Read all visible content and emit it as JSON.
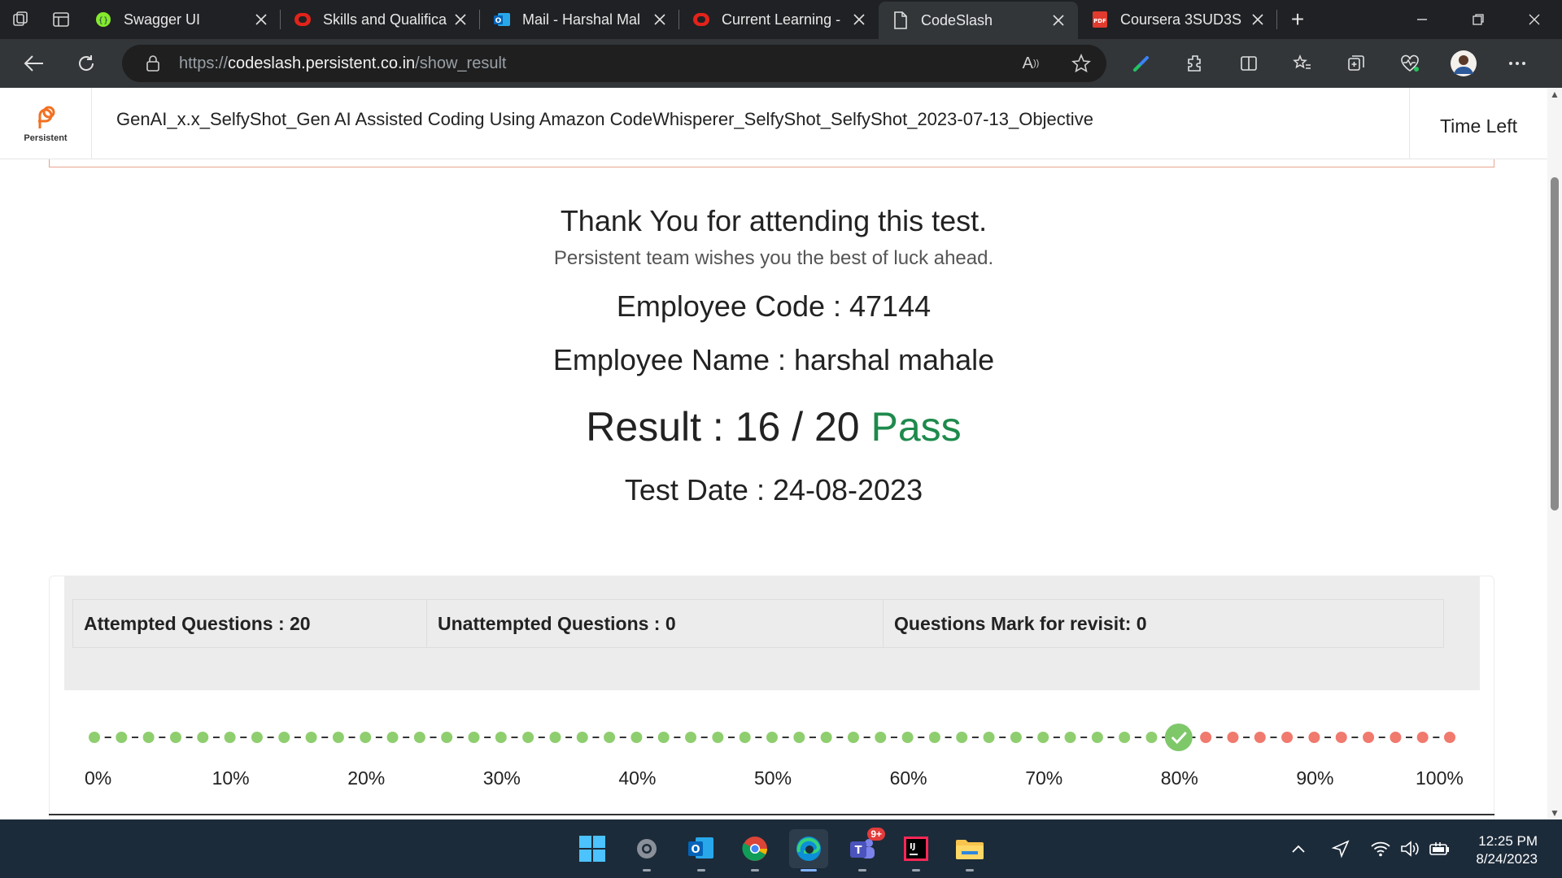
{
  "browser": {
    "tabs": [
      {
        "label": "Swagger UI",
        "icon": "swagger-icon"
      },
      {
        "label": "Skills and Qualifica",
        "icon": "oracle-icon"
      },
      {
        "label": "Mail - Harshal Mal",
        "icon": "outlook-icon"
      },
      {
        "label": "Current Learning -",
        "icon": "oracle-icon"
      },
      {
        "label": "CodeSlash",
        "icon": "page-icon",
        "active": true
      },
      {
        "label": "Coursera 3SUD3S",
        "icon": "pdf-icon"
      }
    ],
    "url_prefix": "https://",
    "url_domain": "codeslash.persistent.co.in",
    "url_path": "/show_result"
  },
  "header": {
    "brand": "Persistent",
    "test_title": "GenAI_x.x_SelfyShot_Gen AI Assisted Coding Using Amazon CodeWhisperer_SelfyShot_SelfyShot_2023-07-13_Objective",
    "time_left_label": "Time Left"
  },
  "result": {
    "thanks": "Thank You for attending this test.",
    "wishes": "Persistent team wishes you the best of luck ahead.",
    "employee_code": "Employee Code : 47144",
    "employee_name": "Employee Name : harshal mahale",
    "result_label": "Result : 16 / 20",
    "status": "Pass",
    "test_date": "Test Date : 24-08-2023"
  },
  "summary": {
    "attempted": "Attempted Questions : 20",
    "unattempted": "Unattempted Questions : 0",
    "revisit": "Questions Mark for revisit: 0"
  },
  "progress": {
    "score_percent": 80,
    "tick_labels": [
      "0%",
      "10%",
      "20%",
      "30%",
      "40%",
      "50%",
      "60%",
      "70%",
      "80%",
      "90%",
      "100%"
    ],
    "pass_color": "#8fce6f",
    "fail_color": "#f07a6e",
    "marker_color": "#7ec86a"
  },
  "taskbar": {
    "apps": [
      "start-icon",
      "settings-icon",
      "outlook-icon",
      "chrome-icon",
      "edge-icon",
      "teams-icon",
      "intellij-icon",
      "file-explorer-icon"
    ],
    "teams_badge": "9+",
    "time": "12:25 PM",
    "date": "8/24/2023"
  }
}
